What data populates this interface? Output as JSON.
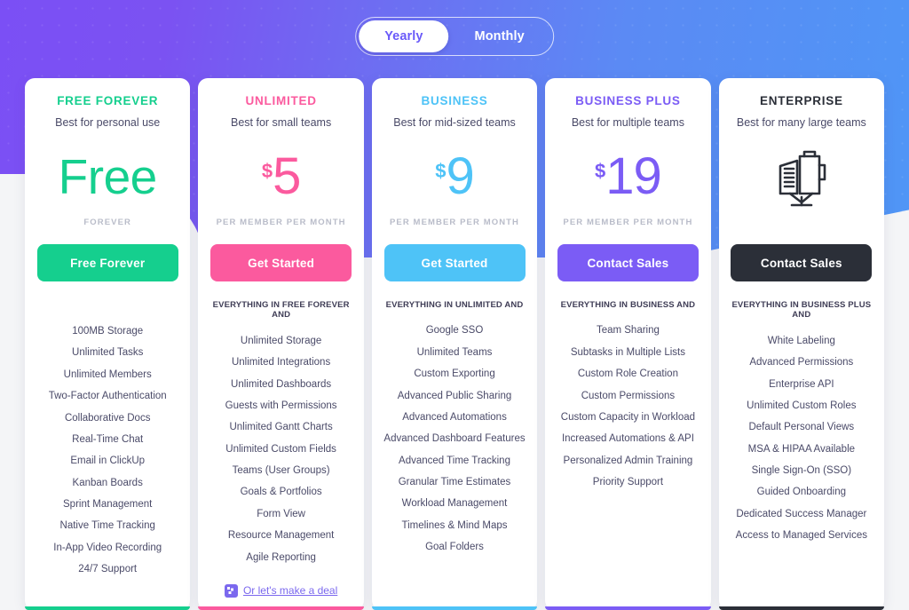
{
  "billing_toggle": {
    "options": [
      {
        "label": "Yearly",
        "selected": true
      },
      {
        "label": "Monthly",
        "selected": false
      }
    ]
  },
  "colors": {
    "free": "#15cf8e",
    "unlimited": "#fb5a9e",
    "business": "#4ec3f7",
    "business_plus": "#7b5cf5",
    "enterprise": "#2b2f38",
    "bg_left": "#7b4ff5",
    "bg_right": "#4f96f6",
    "link": "#7b68ee"
  },
  "plans": [
    {
      "id": "free-forever",
      "name": "FREE FOREVER",
      "tagline": "Best for personal use",
      "price_currency": "",
      "price_amount": "Free",
      "price_note": "FOREVER",
      "cta_label": "Free Forever",
      "features_head": "",
      "features": [
        "100MB Storage",
        "Unlimited Tasks",
        "Unlimited Members",
        "Two-Factor Authentication",
        "Collaborative Docs",
        "Real-Time Chat",
        "Email in ClickUp",
        "Kanban Boards",
        "Sprint Management",
        "Native Time Tracking",
        "In-App Video Recording",
        "24/7 Support"
      ]
    },
    {
      "id": "unlimited",
      "name": "UNLIMITED",
      "tagline": "Best for small teams",
      "price_currency": "$",
      "price_amount": "5",
      "price_note": "PER MEMBER PER MONTH",
      "cta_label": "Get Started",
      "features_head": "EVERYTHING IN FREE FOREVER AND",
      "features": [
        "Unlimited Storage",
        "Unlimited Integrations",
        "Unlimited Dashboards",
        "Guests with Permissions",
        "Unlimited Gantt Charts",
        "Unlimited Custom Fields",
        "Teams (User Groups)",
        "Goals & Portfolios",
        "Form View",
        "Resource Management",
        "Agile Reporting"
      ],
      "deal_link": "Or let's make a deal"
    },
    {
      "id": "business",
      "name": "BUSINESS",
      "tagline": "Best for mid-sized teams",
      "price_currency": "$",
      "price_amount": "9",
      "price_note": "PER MEMBER PER MONTH",
      "cta_label": "Get Started",
      "features_head": "EVERYTHING IN UNLIMITED AND",
      "features": [
        "Google SSO",
        "Unlimited Teams",
        "Custom Exporting",
        "Advanced Public Sharing",
        "Advanced Automations",
        "Advanced Dashboard Features",
        "Advanced Time Tracking",
        "Granular Time Estimates",
        "Workload Management",
        "Timelines & Mind Maps",
        "Goal Folders"
      ]
    },
    {
      "id": "business-plus",
      "name": "BUSINESS PLUS",
      "tagline": "Best for multiple teams",
      "price_currency": "$",
      "price_amount": "19",
      "price_note": "PER MEMBER PER MONTH",
      "cta_label": "Contact Sales",
      "features_head": "EVERYTHING IN BUSINESS AND",
      "features": [
        "Team Sharing",
        "Subtasks in Multiple Lists",
        "Custom Role Creation",
        "Custom Permissions",
        "Custom Capacity in Workload",
        "Increased Automations & API",
        "Personalized Admin Training",
        "Priority Support"
      ]
    },
    {
      "id": "enterprise",
      "name": "ENTERPRISE",
      "tagline": "Best for many large teams",
      "price_currency": "",
      "price_amount": "",
      "price_note": "",
      "icon": "office-building-icon",
      "cta_label": "Contact Sales",
      "features_head": "EVERYTHING IN BUSINESS PLUS AND",
      "features": [
        "White Labeling",
        "Advanced Permissions",
        "Enterprise API",
        "Unlimited Custom Roles",
        "Default Personal Views",
        "MSA & HIPAA Available",
        "Single Sign-On (SSO)",
        "Guided Onboarding",
        "Dedicated Success Manager",
        "Access to Managed Services"
      ]
    }
  ]
}
